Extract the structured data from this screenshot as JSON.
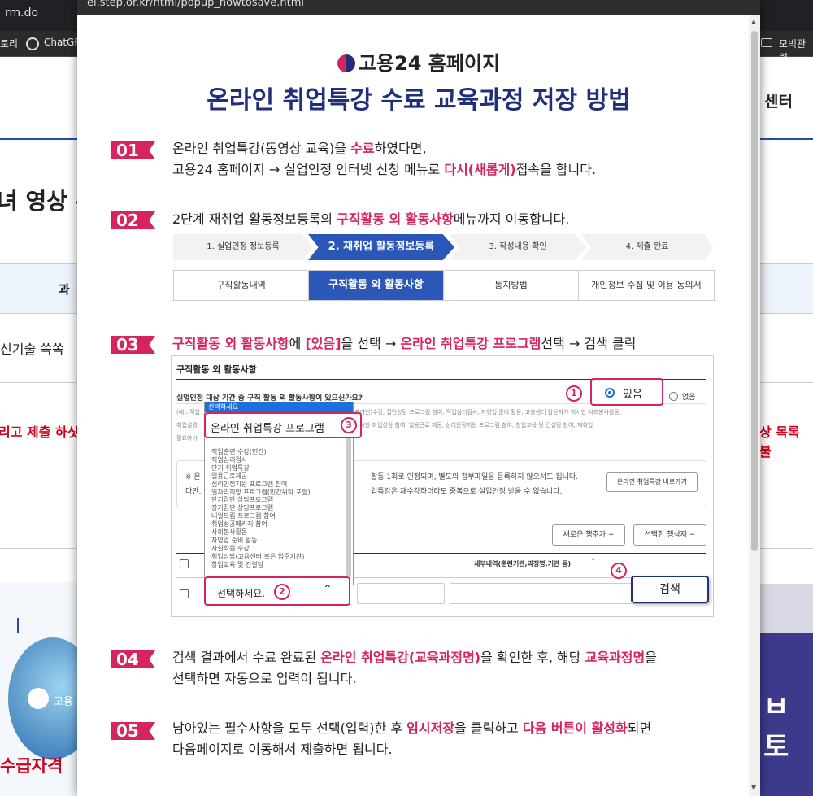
{
  "background": {
    "tab_title": "rm.do",
    "bookmark_left": "토리",
    "bookmark_chatgpt": "ChatGP",
    "bookmark_right": "모빅관련",
    "header_right": "센터",
    "heading_left": "녀 영상 수",
    "table_header_left": "과",
    "row_text_left": "신기술 쏙쏙",
    "red_left": "리고 제출 하싯",
    "red_right": "상 목록 불",
    "logo_text": "고용",
    "bottom_left": "수급자격",
    "right_banner_text": "ㅂ토"
  },
  "popup": {
    "url": "ei.step.or.kr/html/popup_howtosave.html",
    "brand": "고용24 홈페이지",
    "title": "온라인 취업특강 수료 교육과정 저장 방법",
    "steps": [
      {
        "num": "01",
        "parts": [
          "온라인 취업특강(동영상 교육)을 ",
          "수료",
          "하였다면,"
        ],
        "line2": [
          "고용24 홈페이지 → 실업인정 인터넷 신청 메뉴로 ",
          "다시(새롭게)",
          "접속을 합니다."
        ]
      },
      {
        "num": "02",
        "parts": [
          "2단계 재취업 활동정보등록의 ",
          "구직활동 외 활동사항",
          "메뉴까지 이동합니다."
        ]
      },
      {
        "num": "03",
        "parts": [
          "구직활동 외 활동사항",
          "에 ",
          "[있음]",
          "을 선택 → ",
          "온라인 취업특강 프로그램",
          "선택 → 검색 클릭"
        ]
      },
      {
        "num": "04",
        "parts": [
          "검색 결과에서 수료 완료된 ",
          "온라인 취업특강(교육과정명)",
          "을 확인한 후, 해당 ",
          "교육과정명",
          "을"
        ],
        "line2": [
          "선택하면 자동으로 입력이 됩니다."
        ]
      },
      {
        "num": "05",
        "parts": [
          "남아있는 필수사항을 모두 선택(입력)한 후 ",
          "임시저장",
          "을 클릭하고 ",
          "다음 버튼이 활성화",
          "되면"
        ],
        "line2": [
          "다음페이지로 이동해서 제출하면 됩니다."
        ]
      }
    ],
    "progress": [
      "1. 실업인정 정보등록",
      "2. 재취업 활동정보등록",
      "3. 작성내용 확인",
      "4. 제출 완료"
    ],
    "tabs": [
      "구직활동내역",
      "구직활동 외 활동사항",
      "통지방법",
      "개인정보 수집 및 이용 동의서"
    ],
    "form": {
      "header": "구직활동 외 활동사항",
      "question": "실업인정 대상 기간 중 구직 활동 외 활동사항이 있으신가요?",
      "yes": "있음",
      "no": "없음",
      "example": "(예 : 직업",
      "example2": "취업설명",
      "example3": "필요하다",
      "desc1": "프라인)수강, 집단상담 프로그램 참여, 직업심리검사, 자영업 준비 활동, 고용센터 담당자가 지시한 사회봉사활동,",
      "desc2": "실시한 취업상담 참여, 일용근로 제공, 심리안정지원 프로그램 참여, 창업교육 및 컨설팅 참여, 재취업",
      "notice_left1": "※ 온",
      "notice_left2": "다만,",
      "notice1": "활동 1회로 인정되며, 별도의 첨부파일을 등록하지 않으셔도 됩니다.",
      "notice2": "업특강은 재수강하더라도 중복으로 실업인정 받을 수 없습니다.",
      "shortcut_btn": "온라인 취업특강 바로가기",
      "add_row": "새로운 행추가 +",
      "del_row": "선택한 행삭제 −",
      "detail_col": "세부내역(훈련기관,과정명,기관 등)",
      "search": "검색",
      "select_placeholder": "선택하세요.",
      "selected_option": "온라인 취업특강 프로그램",
      "dropdown_top": "선택하세요",
      "options": [
        "직업훈련 수강(민간)",
        "직업심리검사",
        "단기 취업특강",
        "일용근로제공",
        "심리안정지원 프로그램 참여",
        "일자리희망 프로그램(민간위탁 포함)",
        "단기집단 상담프로그램",
        "장기집단 상담프로그램",
        "내일드림 프로그램 참여",
        "취업성공패키지 참여",
        "사회봉사활동",
        "자영업 준비 활동",
        "사설학원 수강",
        "취업상담(고용센터 혹은 입주기관)",
        "창업교육 및 컨설팅"
      ],
      "markers": [
        "1",
        "2",
        "3",
        "4"
      ]
    }
  }
}
